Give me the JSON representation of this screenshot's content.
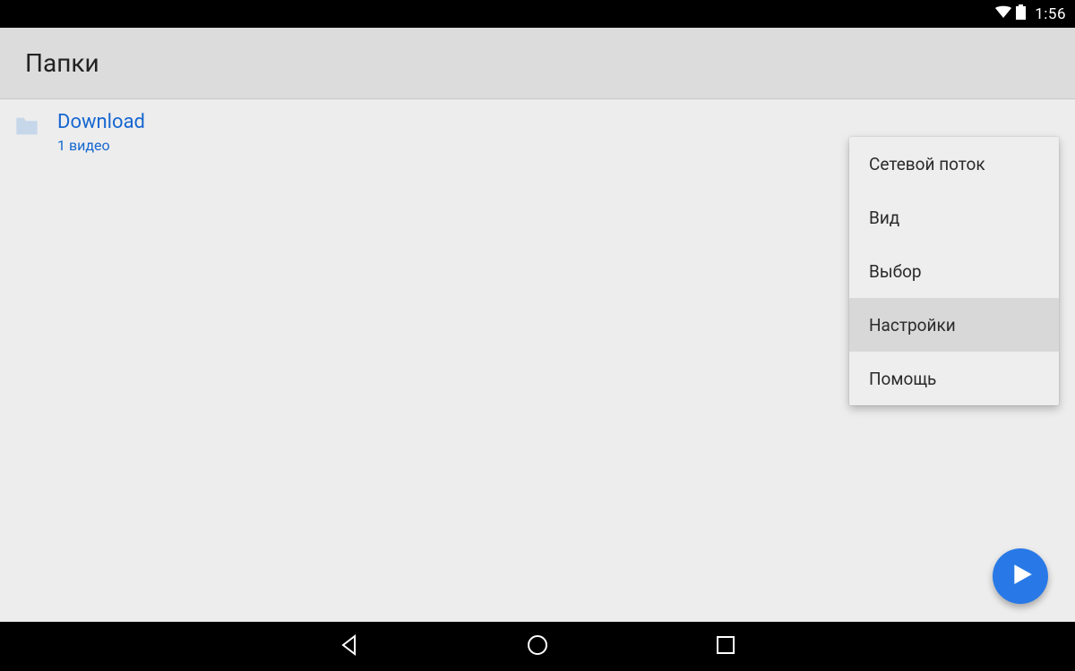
{
  "statusbar": {
    "time": "1:56"
  },
  "appbar": {
    "title": "Папки"
  },
  "list": {
    "items": [
      {
        "title": "Download",
        "subtitle": "1 видео"
      }
    ]
  },
  "menu": {
    "items": [
      {
        "label": "Сетевой поток",
        "highlight": false
      },
      {
        "label": "Вид",
        "highlight": false
      },
      {
        "label": "Выбор",
        "highlight": false
      },
      {
        "label": "Настройки",
        "highlight": true
      },
      {
        "label": "Помощь",
        "highlight": false
      }
    ]
  }
}
